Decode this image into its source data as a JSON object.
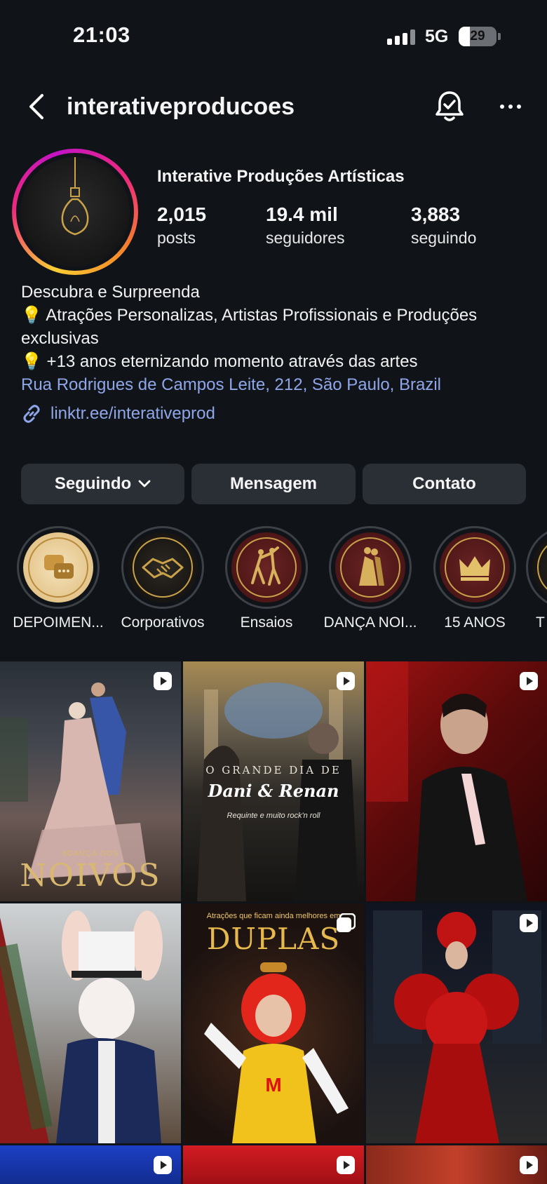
{
  "status_bar": {
    "time": "21:03",
    "network": "5G",
    "battery": "29",
    "battery_level": 0.29
  },
  "header": {
    "username": "interativeproducoes"
  },
  "profile": {
    "full_name": "Interative Produções Artísticas",
    "stats": [
      {
        "value": "2,015",
        "label": "posts"
      },
      {
        "value": "19.4 mil",
        "label": "seguidores"
      },
      {
        "value": "3,883",
        "label": "seguindo"
      }
    ],
    "bio": {
      "line1": "Descubra e Surpreenda",
      "line2": "💡 Atrações Personalizas, Artistas Profissionais e Produções",
      "line3": "exclusivas",
      "line4": "💡 +13 anos eternizando momento através das artes",
      "address": "Rua Rodrigues de Campos Leite, 212, São Paulo, Brazil"
    },
    "link": "linktr.ee/interativeprod"
  },
  "actions": {
    "following": "Seguindo",
    "message": "Mensagem",
    "contact": "Contato"
  },
  "highlights": [
    {
      "label": "DEPOIMEN...",
      "icon": "chat-bubbles-icon"
    },
    {
      "label": "Corporativos",
      "icon": "handshake-icon"
    },
    {
      "label": "Ensaios",
      "icon": "dancing-couple-icon"
    },
    {
      "label": "DANÇA NOI...",
      "icon": "bride-groom-icon"
    },
    {
      "label": "15 ANOS",
      "icon": "crown-icon"
    },
    {
      "label": "T",
      "icon": "highlight-icon"
    }
  ],
  "posts": {
    "p1": {
      "caption_small": "#DANÇA DOS",
      "caption_big": "NOIVOS",
      "icon": "reel-icon"
    },
    "p2": {
      "line1": "O GRANDE DIA DE",
      "line2": "Dani & Renan",
      "line3": "Requinte e muito rock'n roll",
      "icon": "reel-icon"
    },
    "p3": {
      "icon": "reel-icon"
    },
    "p4": {
      "icon": "none"
    },
    "p5": {
      "line1": "Atrações que ficam ainda melhores em",
      "line2": "DUPLAS",
      "icon": "carousel-icon"
    },
    "p6": {
      "icon": "reel-icon"
    }
  },
  "colors": {
    "background": "#101419",
    "button": "#2a2f35",
    "link": "#8fa6e8",
    "accent_gold": "#c9a24a"
  }
}
